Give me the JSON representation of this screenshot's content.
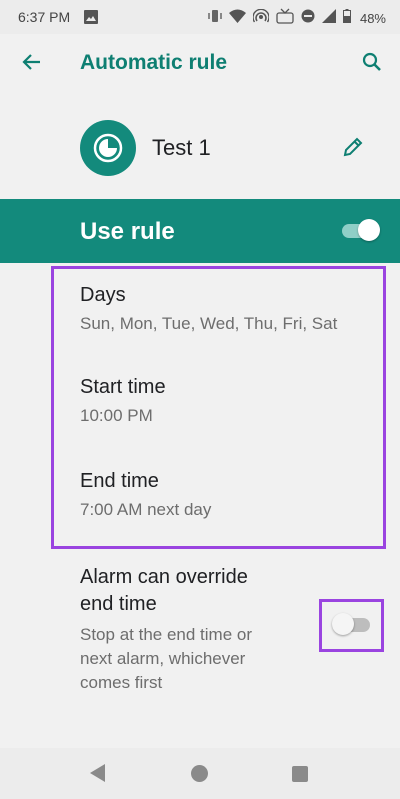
{
  "status_bar": {
    "time": "6:37 PM",
    "battery_percent": "48%",
    "icons": [
      "image-icon",
      "vibrate-icon",
      "wifi-icon",
      "hotspot-icon",
      "volte-icon",
      "dnd-icon",
      "signal-icon",
      "battery-icon"
    ]
  },
  "app_bar": {
    "title": "Automatic rule",
    "back_icon": "arrow-left-icon",
    "search_icon": "search-icon"
  },
  "rule": {
    "name": "Test 1",
    "icon": "clock-icon",
    "edit_icon": "pencil-icon"
  },
  "use_rule": {
    "label": "Use rule",
    "enabled": true
  },
  "settings": {
    "days": {
      "title": "Days",
      "value": "Sun, Mon, Tue, Wed, Thu, Fri, Sat"
    },
    "start_time": {
      "title": "Start time",
      "value": "10:00 PM"
    },
    "end_time": {
      "title": "End time",
      "value": "7:00 AM next day"
    },
    "alarm_override": {
      "title_line1": "Alarm can override",
      "title_line2": "end time",
      "summary_line1": "Stop at the end time or",
      "summary_line2": "next alarm, whichever",
      "summary_line3": "comes first",
      "enabled": false
    }
  },
  "colors": {
    "accent": "#138a7c",
    "title_accent": "#0e7f72",
    "highlight": "#9a44e0",
    "background": "#f1f1f1"
  },
  "nav_bar": {
    "icons": [
      "nav-back-icon",
      "nav-home-icon",
      "nav-recents-icon"
    ]
  }
}
